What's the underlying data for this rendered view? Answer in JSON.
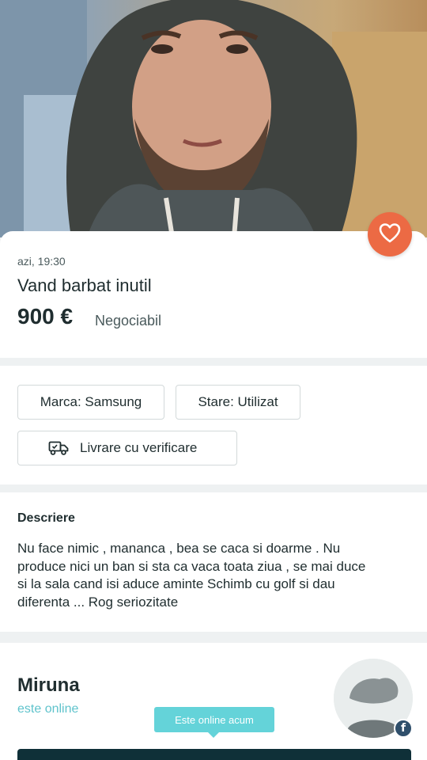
{
  "listing": {
    "timestamp": "azi, 19:30",
    "title": "Vand barbat inutil",
    "price": "900 €",
    "negotiable": "Negociabil"
  },
  "attributes": {
    "brand": "Marca: Samsung",
    "condition": "Stare: Utilizat",
    "delivery": "Livrare cu verificare"
  },
  "description": {
    "heading": "Descriere",
    "lines": [
      "Nu face nimic , mananca , bea se caca si doarme . Nu",
      "produce nici un ban si sta ca vaca toata ziua , se mai duce",
      "si la sala cand isi aduce aminte Schimb cu golf si dau",
      "diferenta ... Rog seriozitate"
    ]
  },
  "seller": {
    "name": "Miruna",
    "status": "este online",
    "tooltip": "Este online acum"
  },
  "icons": {
    "favorite": "heart-icon",
    "delivery": "truck-icon",
    "social": "facebook-icon"
  },
  "colors": {
    "accent": "#ec6a44",
    "online": "#64d3d9",
    "dark": "#0f3038"
  }
}
